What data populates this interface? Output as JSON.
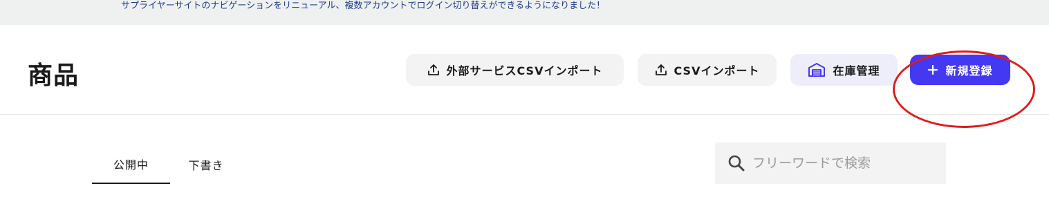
{
  "announcement": {
    "text": "サプライヤーサイトのナビゲーションをリニューアル、複数アカウントでログイン切り替えができるようになりました！"
  },
  "header": {
    "title": "商品",
    "buttons": {
      "external_csv_import": {
        "label": "外部サービスCSVインポート",
        "icon": "upload-icon"
      },
      "csv_import": {
        "label": "CSVインポート",
        "icon": "upload-icon"
      },
      "inventory": {
        "label": "在庫管理",
        "icon": "warehouse-icon"
      },
      "new_register": {
        "label": "新規登録",
        "icon": "plus-icon"
      }
    }
  },
  "tabs": [
    {
      "label": "公開中",
      "active": true
    },
    {
      "label": "下書き",
      "active": false
    }
  ],
  "search": {
    "placeholder": "フリーワードで検索",
    "value": ""
  },
  "colors": {
    "primary": "#4339f2",
    "annotation": "#e01b1b",
    "announcement_bg": "#eef1f0",
    "announcement_text": "#1f3a8a"
  }
}
